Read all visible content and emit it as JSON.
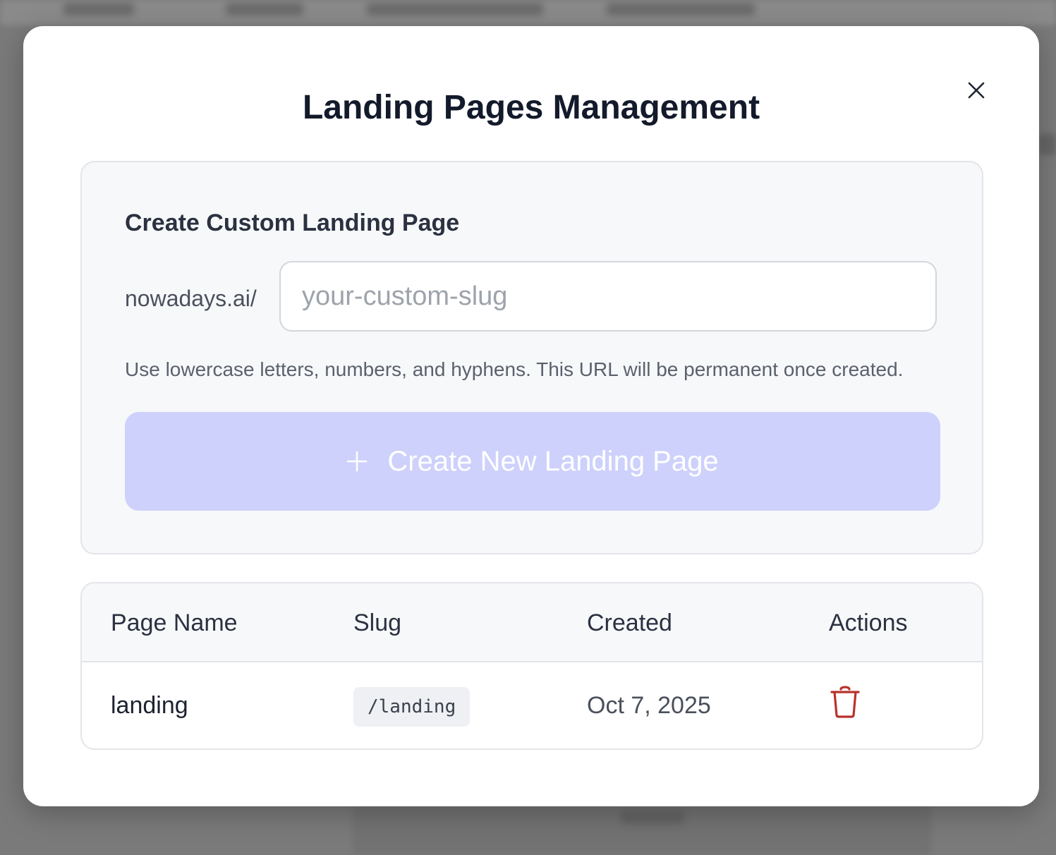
{
  "modal": {
    "title": "Landing Pages Management",
    "close_icon": "close-icon"
  },
  "create": {
    "heading": "Create Custom Landing Page",
    "prefix": "nowadays.ai/",
    "slug_value": "",
    "slug_placeholder": "your-custom-slug",
    "helper": "Use lowercase letters, numbers, and hyphens. This URL will be permanent once created.",
    "button_icon": "plus-icon",
    "button_label": "Create New Landing Page",
    "button_color": "#cdd1fb"
  },
  "table": {
    "headers": {
      "page_name": "Page Name",
      "slug": "Slug",
      "created": "Created",
      "actions": "Actions"
    },
    "rows": [
      {
        "page_name": "landing",
        "slug": "/landing",
        "created": "Oct 7, 2025",
        "action_icon": "trash-icon",
        "action_color": "#b8322c"
      }
    ]
  }
}
